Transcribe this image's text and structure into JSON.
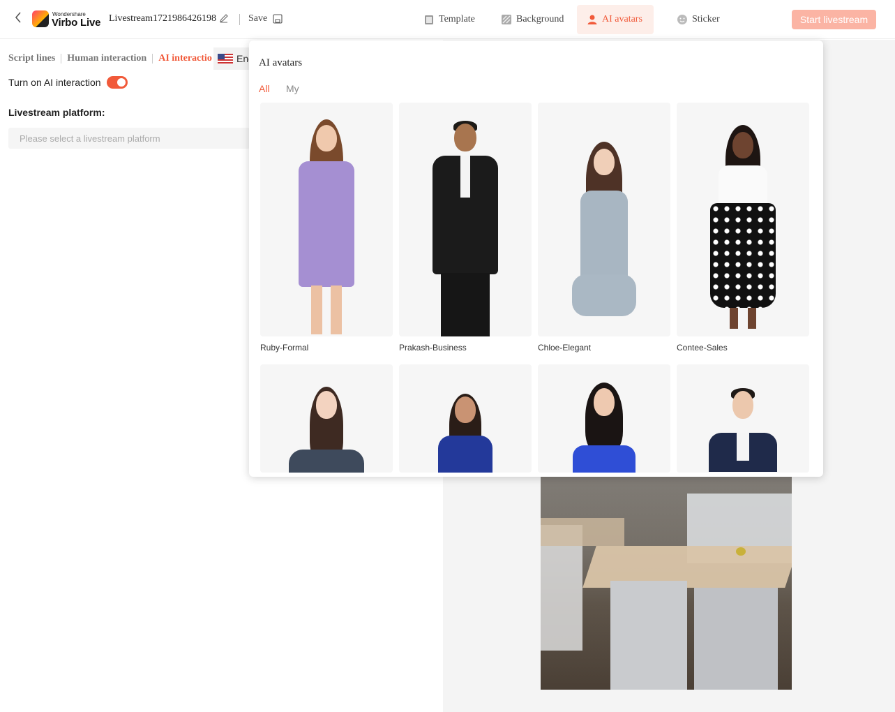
{
  "header": {
    "back_icon": "chevron-left-icon",
    "brand_small": "Wondershare",
    "brand_big": "Virbo Live",
    "project_title": "Livestream1721986426198",
    "save_label": "Save",
    "nav": [
      {
        "label": "Template",
        "icon": "template-icon"
      },
      {
        "label": "Background",
        "icon": "background-icon"
      },
      {
        "label": "AI avatars",
        "icon": "avatar-icon"
      },
      {
        "label": "Sticker",
        "icon": "sticker-icon"
      }
    ],
    "start_label": "Start livestream"
  },
  "left_panel": {
    "tabs": [
      {
        "label": "Script lines"
      },
      {
        "label": "Human interaction"
      },
      {
        "label": "AI interactio"
      }
    ],
    "language": "Eng",
    "toggle_label": "Turn on AI interaction",
    "toggle_on": true,
    "platform_label": "Livestream platform:",
    "platform_placeholder": "Please select a livestream platform"
  },
  "popover": {
    "title": "AI avatars",
    "tabs": [
      {
        "label": "All",
        "active": true
      },
      {
        "label": "My",
        "active": false
      }
    ],
    "avatars": [
      {
        "name": "Ruby-Formal"
      },
      {
        "name": "Prakash-Business"
      },
      {
        "name": "Chloe-Elegant"
      },
      {
        "name": "Contee-Sales"
      },
      {
        "name": ""
      },
      {
        "name": ""
      },
      {
        "name": ""
      },
      {
        "name": ""
      }
    ]
  },
  "colors": {
    "accent": "#f15a3a",
    "accent_light": "#fdeee9",
    "start_button": "#fbb4a4"
  }
}
